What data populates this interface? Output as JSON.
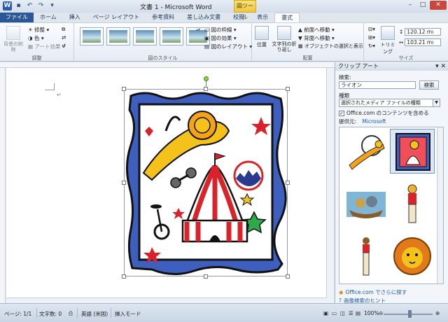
{
  "titlebar": {
    "title": "文書 1 - Microsoft Word",
    "context_tool": "図ツール",
    "app_icon": "W"
  },
  "tabs": [
    {
      "label": "ファイル"
    },
    {
      "label": "ホーム"
    },
    {
      "label": "挿入"
    },
    {
      "label": "ページ レイアウト"
    },
    {
      "label": "参考資料"
    },
    {
      "label": "差し込み文書"
    },
    {
      "label": "校閲"
    },
    {
      "label": "表示"
    },
    {
      "label": "書式"
    }
  ],
  "ribbon": {
    "adjust": {
      "remove_bg": "背景の削除",
      "corrections": "修整",
      "color": "色",
      "artistic": "アート効果",
      "label": "調整"
    },
    "styles": {
      "border": "図の枠線",
      "effects": "図の効果",
      "layout": "図のレイアウト",
      "label": "図のスタイル"
    },
    "arrange": {
      "position": "位置",
      "wrap": "文字列の折り返し",
      "bring_forward": "前面へ移動",
      "send_backward": "背面へ移動",
      "selection_pane": "オブジェクトの選択と表示",
      "label": "配置"
    },
    "size": {
      "crop": "トリミング",
      "height": "120.12 mı",
      "width": "103.21 mı",
      "label": "サイズ"
    }
  },
  "taskpane": {
    "title": "クリップ アート",
    "search_label": "検索:",
    "search_value": "ライオン",
    "search_button": "検索",
    "type_label": "種類",
    "type_value": "選択されたメディア ファイルの種類",
    "include_office": "Office.com のコンテンツを含める",
    "provider_label": "提供元:",
    "provider_value": "Microsoft",
    "more_link": "Office.com でさらに探す",
    "hint_link": "画像検索のヒント"
  },
  "status": {
    "page": "ページ: 1/1",
    "words": "文字数: 0",
    "language": "英語 (米国)",
    "mode": "挿入モード",
    "zoom": "100%"
  },
  "colors": {
    "file_tab": "#2b5797",
    "context_tab": "#efc640",
    "frame_blue": "#3f5fbf",
    "tent_red": "#d9232a",
    "lion_yellow": "#f5c21b"
  }
}
